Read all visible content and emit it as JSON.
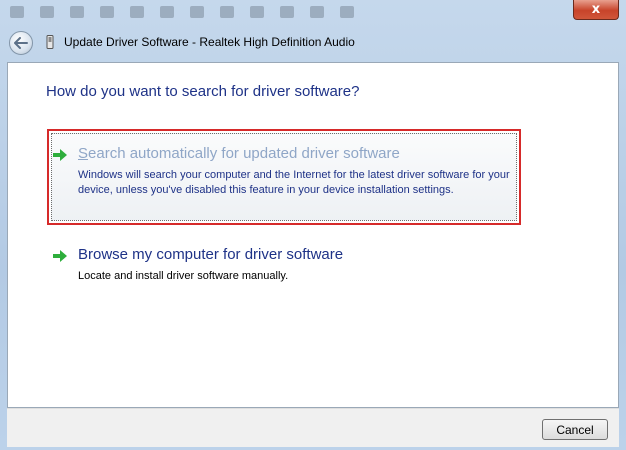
{
  "window": {
    "title": "Update Driver Software - Realtek High Definition Audio",
    "close_label": "x"
  },
  "page": {
    "heading": "How do you want to search for driver software?"
  },
  "options": [
    {
      "title": "Search automatically for updated driver software",
      "title_first_letter": "S",
      "title_rest": "earch automatically for updated driver software",
      "description": "Windows will search your computer and the Internet for the latest driver software for your device, unless you've disabled this feature in your device installation settings.",
      "selected": true,
      "icon": "green-arrow-icon"
    },
    {
      "title": "Browse my computer for driver software",
      "description": "Locate and install driver software manually.",
      "selected": false,
      "icon": "green-arrow-icon"
    }
  ],
  "footer": {
    "cancel_label": "Cancel"
  },
  "colors": {
    "heading": "#1e3287",
    "highlight_border": "#d62a2a",
    "arrow": "#2eae3c"
  }
}
